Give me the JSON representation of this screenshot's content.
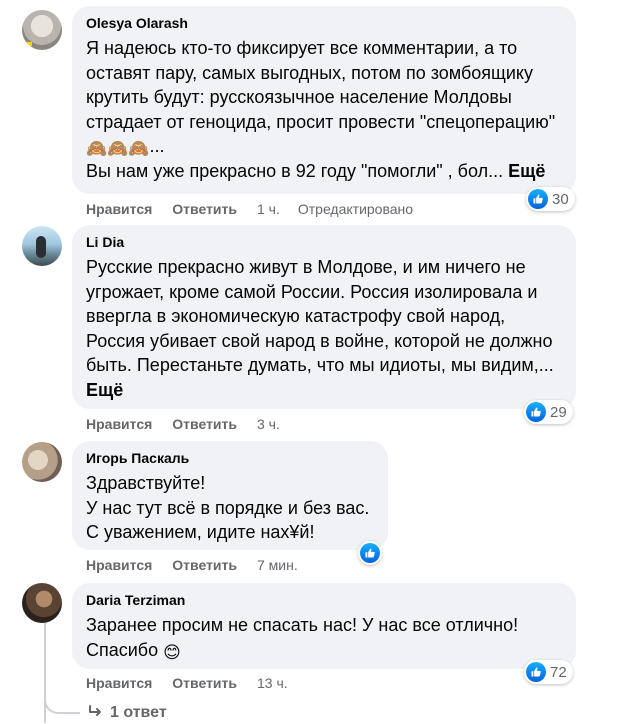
{
  "comments": [
    {
      "author": "Olesya Olarash",
      "text": "Я надеюсь кто-то фиксирует все комментарии, а то оставят пару, самых выгодных, потом по зомбоящику крутить будут: русскоязычное население Молдовы страдает от геноцида, просит провести \"спецоперацию\"",
      "emoji": "🙈🙈🙈",
      "text_after_emoji": "...",
      "text_line2": "Вы нам уже прекрасно в 92 году \"помогли\" , бол...",
      "more": "Ещё",
      "like": "Нравится",
      "reply": "Ответить",
      "time": "1 ч.",
      "edited": "Отредактировано",
      "reactions": "30"
    },
    {
      "author": "Li Dia",
      "text": "Русские прекрасно живут в Молдове, и им ничего не угрожает, кроме самой России. Россия изолировала и ввергла в экономическую катастрофу свой народ, Россия убивает свой народ в войне, которой не должно быть. Перестаньте думать, что мы идиоты, мы видим,...",
      "more": "Ещё",
      "like": "Нравится",
      "reply": "Ответить",
      "time": "3 ч.",
      "reactions": "29"
    },
    {
      "author": "Игорь Паскаль",
      "text": "Здравствуйте!\nУ нас тут всё в порядке и без вас.\nС уважением, идите нах¥й!",
      "like": "Нравится",
      "reply": "Ответить",
      "time": "7 мин.",
      "reactions": ""
    },
    {
      "author": "Daria Terziman",
      "text": "Заранее просим не спасать нас! У нас все отлично! Спасибо",
      "emoji": "😊",
      "like": "Нравится",
      "reply": "Ответить",
      "time": "13 ч.",
      "reactions": "72"
    }
  ],
  "replies_link": "1 ответ",
  "icons": {
    "like": "thumbs-up-icon",
    "reply_arrow": "reply-arrow-icon"
  },
  "colors": {
    "bubble": "#f0f2f5",
    "meta": "#65676b",
    "like_blue": "#1877f2"
  }
}
